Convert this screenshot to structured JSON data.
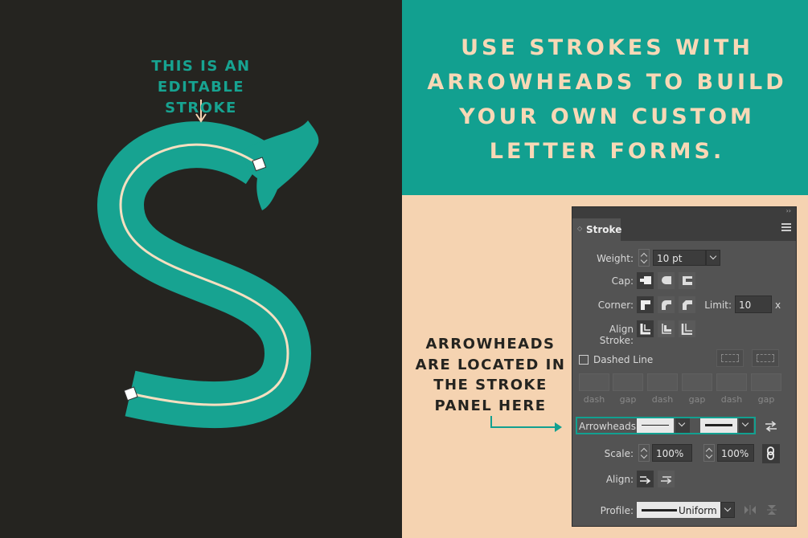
{
  "notes": {
    "top": "This is an editable stroke",
    "headline": "Use strokes with arrowheads to build your own custom letter forms.",
    "bottom": "Arrowheads are located in the stroke panel here"
  },
  "colors": {
    "teal": "#12a090",
    "dark": "#252420",
    "cream": "#f5d3b1",
    "panel": "#535353"
  },
  "panel": {
    "title": "Stroke",
    "weight_label": "Weight:",
    "weight_value": "10 pt",
    "cap_label": "Cap:",
    "corner_label": "Corner:",
    "limit_label": "Limit:",
    "limit_value": "10",
    "limit_unit": "x",
    "align_stroke_label": "Align Stroke:",
    "dashed_line_label": "Dashed Line",
    "dash_labels": [
      "dash",
      "gap",
      "dash",
      "gap",
      "dash",
      "gap"
    ],
    "arrowheads_label": "Arrowheads:",
    "scale_label": "Scale:",
    "scale_start": "100%",
    "scale_end": "100%",
    "align_label": "Align:",
    "profile_label": "Profile:",
    "profile_value": "Uniform"
  }
}
